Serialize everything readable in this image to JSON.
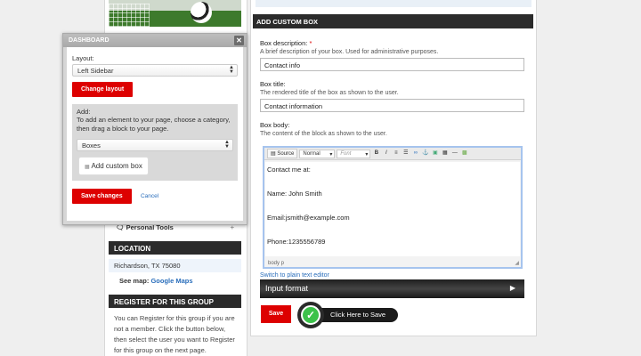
{
  "dashboard": {
    "title": "DASHBOARD",
    "close_icon": "close-icon",
    "layout_label": "Layout:",
    "layout_value": "Left Sidebar",
    "change_layout_label": "Change layout",
    "add_label": "Add:",
    "add_help": "To add an element to your page, choose a category, then drag a block to your page.",
    "category_value": "Boxes",
    "add_custom_box_label": "Add custom box",
    "save_changes_label": "Save changes",
    "cancel_label": "Cancel"
  },
  "sidebar": {
    "personal_tools_label": "Personal Tools",
    "location_title": "LOCATION",
    "location_value": "Richardson, TX 75080",
    "see_map_label": "See map:",
    "google_maps_label": "Google Maps",
    "register_title": "REGISTER FOR THIS GROUP",
    "register_text": "You can Register for this group if you are not a member. Click the button below, then select the user you want to Register for this group on the next page."
  },
  "form": {
    "title": "ADD CUSTOM BOX",
    "desc_label": "Box description:",
    "desc_required": "*",
    "desc_help": "A brief description of your box. Used for administrative purposes.",
    "desc_value": "Contact info",
    "box_title_label": "Box title:",
    "box_title_help": "The rendered title of the box as shown to the user.",
    "box_title_value": "Contact information",
    "body_label": "Box body:",
    "body_help": "The content of the block as shown to the user.",
    "editor": {
      "source_label": "Source",
      "format_value": "Normal",
      "font_value": "Font",
      "lines": [
        "Contact me at:",
        "",
        "Name: John Smith",
        "",
        "Email:jsmith@example.com",
        "",
        "Phone:1235556789"
      ],
      "status_path": "body  p"
    },
    "plain_text_link": "Switch to plain text editor",
    "input_format_label": "Input format",
    "save_label": "Save",
    "callout_text": "Click Here to Save"
  },
  "colors": {
    "accent_red": "#dd0000",
    "dark_bar": "#2b2b2b",
    "link_blue": "#2a6ebb",
    "check_green": "#3cc24a"
  }
}
